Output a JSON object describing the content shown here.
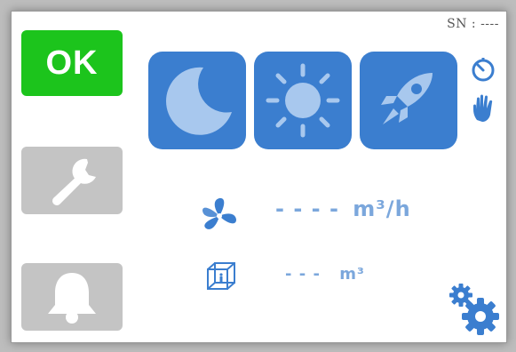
{
  "header": {
    "serial": "SN : ----"
  },
  "status": {
    "label": "OK",
    "color": "#1cc41c"
  },
  "sidebar": {
    "service_icon": "wrench-icon",
    "alarm_icon": "bell-icon"
  },
  "modes": [
    {
      "icon": "moon-icon",
      "name": "night"
    },
    {
      "icon": "sun-icon",
      "name": "day"
    },
    {
      "icon": "rocket-icon",
      "name": "boost"
    }
  ],
  "control_mode_icons": [
    "timer-icon",
    "manual-hand-icon"
  ],
  "airflow": {
    "icon": "fan-icon",
    "value": "- - - -",
    "unit": "m³/h"
  },
  "volume": {
    "icon": "room-cube-icon",
    "value": "- - -",
    "unit": "m³"
  },
  "settings_icon": "gears-icon",
  "colors": {
    "accent": "#3b7ecf",
    "accent_light": "#7ba7dc",
    "ok": "#1cc41c",
    "disabled": "#c4c4c4"
  }
}
